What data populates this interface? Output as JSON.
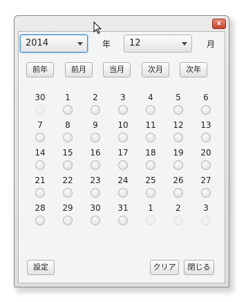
{
  "titlebar": {
    "close_icon": "close-icon",
    "close_glyph": "x"
  },
  "year": {
    "value": "2014",
    "unit": "年"
  },
  "month": {
    "value": "12",
    "unit": "月"
  },
  "nav_buttons": [
    "前年",
    "前月",
    "当月",
    "次月",
    "次年"
  ],
  "days": [
    {
      "label": "30",
      "enabled": false
    },
    {
      "label": "1",
      "enabled": true
    },
    {
      "label": "2",
      "enabled": true
    },
    {
      "label": "3",
      "enabled": true
    },
    {
      "label": "4",
      "enabled": true
    },
    {
      "label": "5",
      "enabled": true
    },
    {
      "label": "6",
      "enabled": true
    },
    {
      "label": "7",
      "enabled": true
    },
    {
      "label": "8",
      "enabled": true
    },
    {
      "label": "9",
      "enabled": true
    },
    {
      "label": "10",
      "enabled": true
    },
    {
      "label": "11",
      "enabled": true
    },
    {
      "label": "12",
      "enabled": true
    },
    {
      "label": "13",
      "enabled": true
    },
    {
      "label": "14",
      "enabled": true
    },
    {
      "label": "15",
      "enabled": true
    },
    {
      "label": "16",
      "enabled": true
    },
    {
      "label": "17",
      "enabled": true
    },
    {
      "label": "18",
      "enabled": true
    },
    {
      "label": "19",
      "enabled": true
    },
    {
      "label": "20",
      "enabled": true
    },
    {
      "label": "21",
      "enabled": true
    },
    {
      "label": "22",
      "enabled": true
    },
    {
      "label": "23",
      "enabled": true
    },
    {
      "label": "24",
      "enabled": true
    },
    {
      "label": "25",
      "enabled": true
    },
    {
      "label": "26",
      "enabled": true
    },
    {
      "label": "27",
      "enabled": true
    },
    {
      "label": "28",
      "enabled": true
    },
    {
      "label": "29",
      "enabled": true
    },
    {
      "label": "30",
      "enabled": true
    },
    {
      "label": "31",
      "enabled": true
    },
    {
      "label": "1",
      "enabled": false
    },
    {
      "label": "2",
      "enabled": false
    },
    {
      "label": "3",
      "enabled": false
    }
  ],
  "footer": {
    "set_label": "設定",
    "clear_label": "クリア",
    "close_label": "閉じる"
  },
  "colors": {
    "focus": "#3d92d6",
    "close_button": "#c5412c"
  }
}
